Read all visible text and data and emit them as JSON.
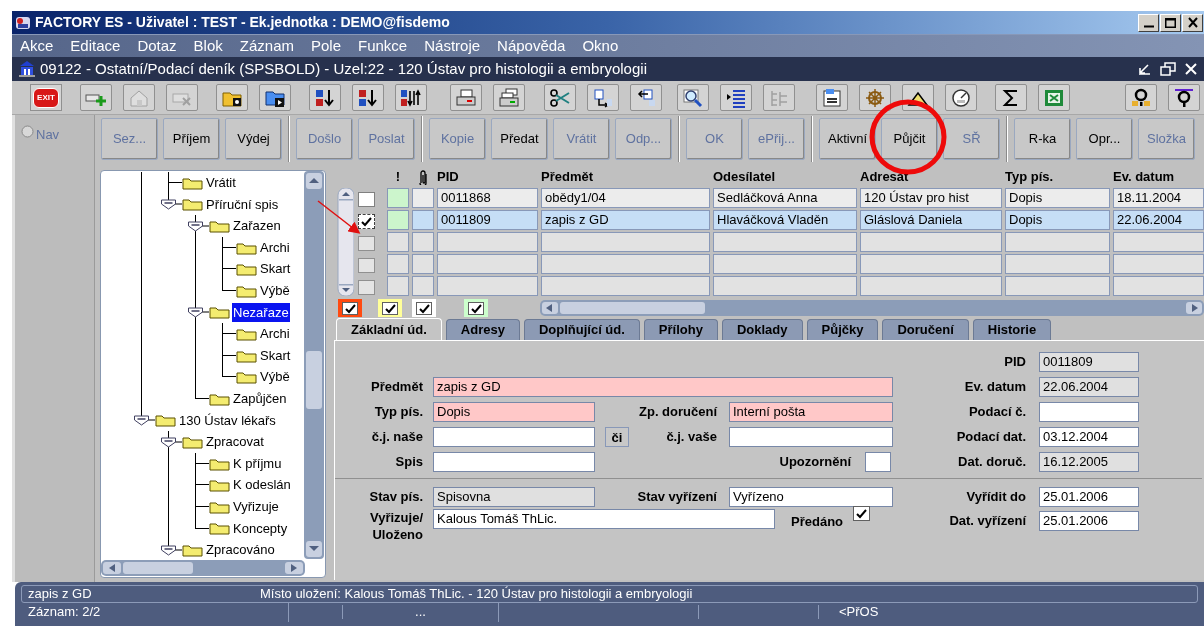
{
  "window": {
    "title": "FACTORY ES - Uživatel : TEST - Ek.jednotka : DEMO@fisdemo"
  },
  "menu": [
    "Akce",
    "Editace",
    "Dotaz",
    "Blok",
    "Záznam",
    "Pole",
    "Funkce",
    "Nástroje",
    "Nápověda",
    "Okno"
  ],
  "form_window": {
    "title": "09122 - Ostatní/Podací deník (SPSBOLD) - Uzel:22 - 120 Ústav pro histologii a embryologii"
  },
  "toolbar": {
    "exit_label": "EXIT"
  },
  "nav": {
    "label": "Nav",
    "selected": false,
    "disabled": true
  },
  "action_groups": [
    [
      {
        "label": "Sez...",
        "disabled": true
      },
      {
        "label": "Příjem",
        "disabled": false
      },
      {
        "label": "Výdej",
        "disabled": false
      }
    ],
    [
      {
        "label": "Došlo",
        "disabled": true
      },
      {
        "label": "Poslat",
        "disabled": true
      }
    ],
    [
      {
        "label": "Kopie",
        "disabled": true
      },
      {
        "label": "Předat",
        "disabled": false
      },
      {
        "label": "Vrátit",
        "disabled": true
      },
      {
        "label": "Odp...",
        "disabled": true
      }
    ],
    [
      {
        "label": "OK",
        "disabled": true
      },
      {
        "label": "ePřij...",
        "disabled": true
      }
    ],
    [
      {
        "label": "Aktivní",
        "disabled": false
      },
      {
        "label": "Půjčit",
        "disabled": false
      },
      {
        "label": "SŘ",
        "disabled": true
      }
    ],
    [
      {
        "label": "R-ka",
        "disabled": false
      },
      {
        "label": "Opr...",
        "disabled": false
      },
      {
        "label": "Složka",
        "disabled": true
      }
    ]
  ],
  "tree": {
    "items": [
      {
        "children": [
          {
            "children": [
              {
                "label": "Vrátit",
                "selected": false
              },
              {
                "label": "Příruční spis",
                "selected": false,
                "expanded": true,
                "children": [
                  {
                    "label": "Zařazen",
                    "selected": false,
                    "expanded": true,
                    "children": [
                      {
                        "label": "Archi",
                        "selected": false
                      },
                      {
                        "label": "Skart",
                        "selected": false
                      },
                      {
                        "label": "Výbě",
                        "selected": false
                      }
                    ]
                  },
                  {
                    "label": "Nezařaze",
                    "selected": true,
                    "expanded": true,
                    "children": [
                      {
                        "label": "Archi",
                        "selected": false
                      },
                      {
                        "label": "Skart",
                        "selected": false
                      },
                      {
                        "label": "Výbě",
                        "selected": false
                      }
                    ]
                  },
                  {
                    "label": "Zapůjčen",
                    "selected": false
                  }
                ]
              }
            ]
          },
          {
            "label": "130 Ústav lékařs",
            "selected": false,
            "expanded": true,
            "children": [
              {
                "label": "Zpracovat",
                "selected": false,
                "expanded": true,
                "children": [
                  {
                    "label": "K příjmu",
                    "selected": false
                  },
                  {
                    "label": "K odeslán",
                    "selected": false
                  },
                  {
                    "label": "Vyřizuje",
                    "selected": false
                  },
                  {
                    "label": "Koncepty",
                    "selected": false
                  }
                ]
              },
              {
                "label": "Zpracováno",
                "selected": false,
                "expanded": true
              }
            ]
          }
        ]
      }
    ]
  },
  "table": {
    "columns": [
      {
        "kind": "text",
        "label": "!"
      },
      {
        "kind": "attachment"
      },
      {
        "kind": "text",
        "label": "PID"
      },
      {
        "kind": "text",
        "label": "Předmět"
      },
      {
        "kind": "text",
        "label": "Odesílatel"
      },
      {
        "kind": "text",
        "label": "Adresát"
      },
      {
        "kind": "text",
        "label": "Typ pís."
      },
      {
        "kind": "text",
        "label": "Ev. datum"
      }
    ],
    "rows": [
      {
        "checked": false,
        "selected": false,
        "color": "#ccf5cc",
        "cells": [
          "",
          "",
          "0011868",
          "obědy1/04",
          "Sedláčková Anna",
          "120 Ústav pro hist",
          "Dopis",
          "18.11.2004"
        ]
      },
      {
        "checked": true,
        "selected": true,
        "color": "#ccf5cc",
        "cells": [
          "",
          "",
          "0011809",
          "zapis z GD",
          "Hlaváčková Vladěn",
          "Gláslová Daniela",
          "Dopis",
          "22.06.2004"
        ]
      },
      {
        "checked": false
      },
      {
        "checked": false
      },
      {
        "checked": false
      }
    ]
  },
  "legend": [
    {
      "color": "#ff4a10",
      "checked": true
    },
    {
      "color": "#ffff99",
      "checked": true
    },
    {
      "color": "#ffffff",
      "checked": true
    },
    {
      "color": "#ccffcc",
      "checked": true
    }
  ],
  "tabs": [
    {
      "label": "Základní úd.",
      "selected": true
    },
    {
      "label": "Adresy",
      "selected": false
    },
    {
      "label": "Doplňující úd.",
      "selected": false
    },
    {
      "label": "Přílohy",
      "selected": false
    },
    {
      "label": "Doklady",
      "selected": false
    },
    {
      "label": "Půjčky",
      "selected": false
    },
    {
      "label": "Doručení",
      "selected": false
    },
    {
      "label": "Historie",
      "selected": false
    }
  ],
  "form": {
    "rows": [
      {
        "kind": "fields",
        "right": {
          "label": "PID",
          "value": "0011809",
          "readonly": true
        }
      },
      {
        "kind": "fields",
        "left": {
          "kind": "wide",
          "label": "Předmět",
          "value": "zapis z GD",
          "required": true
        },
        "right": {
          "label": "Ev. datum",
          "value": "22.06.2004",
          "readonly": true
        }
      },
      {
        "kind": "fields",
        "left": {
          "kind": "normal",
          "label": "Typ pís.",
          "value": "Dopis",
          "required": true
        },
        "middle": {
          "kind": "field",
          "label": "Zp. doručení",
          "value": "Interní pošta",
          "required": true
        },
        "right": {
          "label": "Podací č."
        }
      },
      {
        "kind": "fields",
        "left": {
          "kind": "normal",
          "label": "č.j. naše"
        },
        "middle": {
          "kind": "lookup",
          "button": "či",
          "label": "č.j. vaše"
        },
        "right": {
          "label": "Podací dat.",
          "value": "03.12.2004"
        }
      },
      {
        "kind": "fields",
        "left": {
          "kind": "normal",
          "label": "Spis"
        },
        "middle": {
          "kind": "box",
          "label": "Upozornění"
        },
        "right": {
          "label": "Dat. doruč.",
          "value": "16.12.2005",
          "readonly": true
        }
      },
      {
        "kind": "divider"
      },
      {
        "kind": "fields",
        "left": {
          "kind": "normal",
          "label": "Stav pís.",
          "value": "Spisovna",
          "readonly": true
        },
        "middle": {
          "kind": "field",
          "label": "Stav vyřízení",
          "value": "Vyřízeno"
        },
        "right": {
          "label": "Vyřídit do",
          "value": "25.01.2006"
        }
      },
      {
        "kind": "fields",
        "left": {
          "kind": "medium",
          "label": "Vyřizuje/ Uloženo",
          "value": "Kalous Tomáš ThLic."
        },
        "middle": {
          "kind": "checkbox",
          "label": "Předáno",
          "checked": true
        },
        "right": {
          "label": "Dat. vyřízení",
          "value": "25.01.2006"
        }
      }
    ]
  },
  "status_bar": {
    "field": "zapis z GD",
    "message": "Místo uložení: Kalous Tomáš ThLic. - 120 Ústav pro histologii a embryologii",
    "record": "Záznam: 2/2",
    "segment": "...",
    "mode": "<PřOS"
  }
}
